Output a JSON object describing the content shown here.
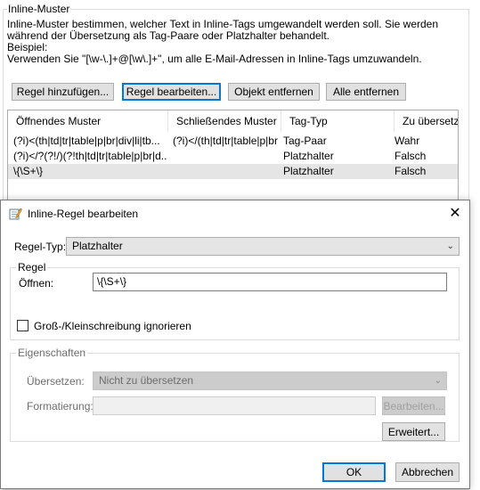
{
  "background": {
    "group_title": "Inline-Muster",
    "description_lines": [
      "Inline-Muster bestimmen, welcher Text in Inline-Tags umgewandelt werden soll. Sie werden",
      "während der Übersetzung als Tag-Paare oder Platzhalter behandelt.",
      "Beispiel:",
      "Verwenden Sie \"[\\w-\\.]+@[\\w\\.]+\", um alle E-Mail-Adressen in Inline-Tags umzuwandeln."
    ],
    "buttons": {
      "add": "Regel hinzufügen...",
      "edit": "Regel bearbeiten...",
      "remove": "Objekt entfernen",
      "remove_all": "Alle entfernen"
    },
    "list": {
      "columns": [
        "Öffnendes Muster",
        "Schließendes Muster",
        "Tag-Typ",
        "Zu übersetzen"
      ],
      "rows": [
        [
          "(?i)<(th|td|tr|table|p|br|div|li|tb...",
          "(?i)</(th|td|tr|table|p|br|div|li|tb...",
          "Tag-Paar",
          "Wahr"
        ],
        [
          "(?i)</?(?!/)(?!th|td|tr|table|p|br|d...",
          "",
          "Platzhalter",
          "Falsch"
        ],
        [
          "\\{\\S+\\}",
          "",
          "Platzhalter",
          "Falsch"
        ]
      ],
      "selected_row": 2
    }
  },
  "dialog": {
    "title": "Inline-Regel bearbeiten",
    "close_glyph": "✕",
    "rule_type_label": "Regel-Typ:",
    "rule_type_value": "Platzhalter",
    "rule_group_title": "Regel",
    "open_label": "Öffnen:",
    "open_value": "\\{\\S+\\}",
    "ignore_case_label": "Groß-/Kleinschreibung ignorieren",
    "ignore_case_checked": false,
    "props_group_title": "Eigenschaften",
    "translate_label": "Übersetzen:",
    "translate_value": "Nicht zu übersetzen",
    "format_label": "Formatierung:",
    "format_value": "",
    "edit_button": "Bearbeiten...",
    "advanced_button": "Erweitert...",
    "ok_button": "OK",
    "cancel_button": "Abbrechen"
  },
  "icons": {
    "dialog_icon": "edit-pencil-icon",
    "combo_arrow": "chevron-down-icon",
    "close": "close-icon"
  },
  "colors": {
    "focus_border": "#0078d7",
    "button_face": "#e1e1e1",
    "selection_row": "#e5e5e5"
  }
}
